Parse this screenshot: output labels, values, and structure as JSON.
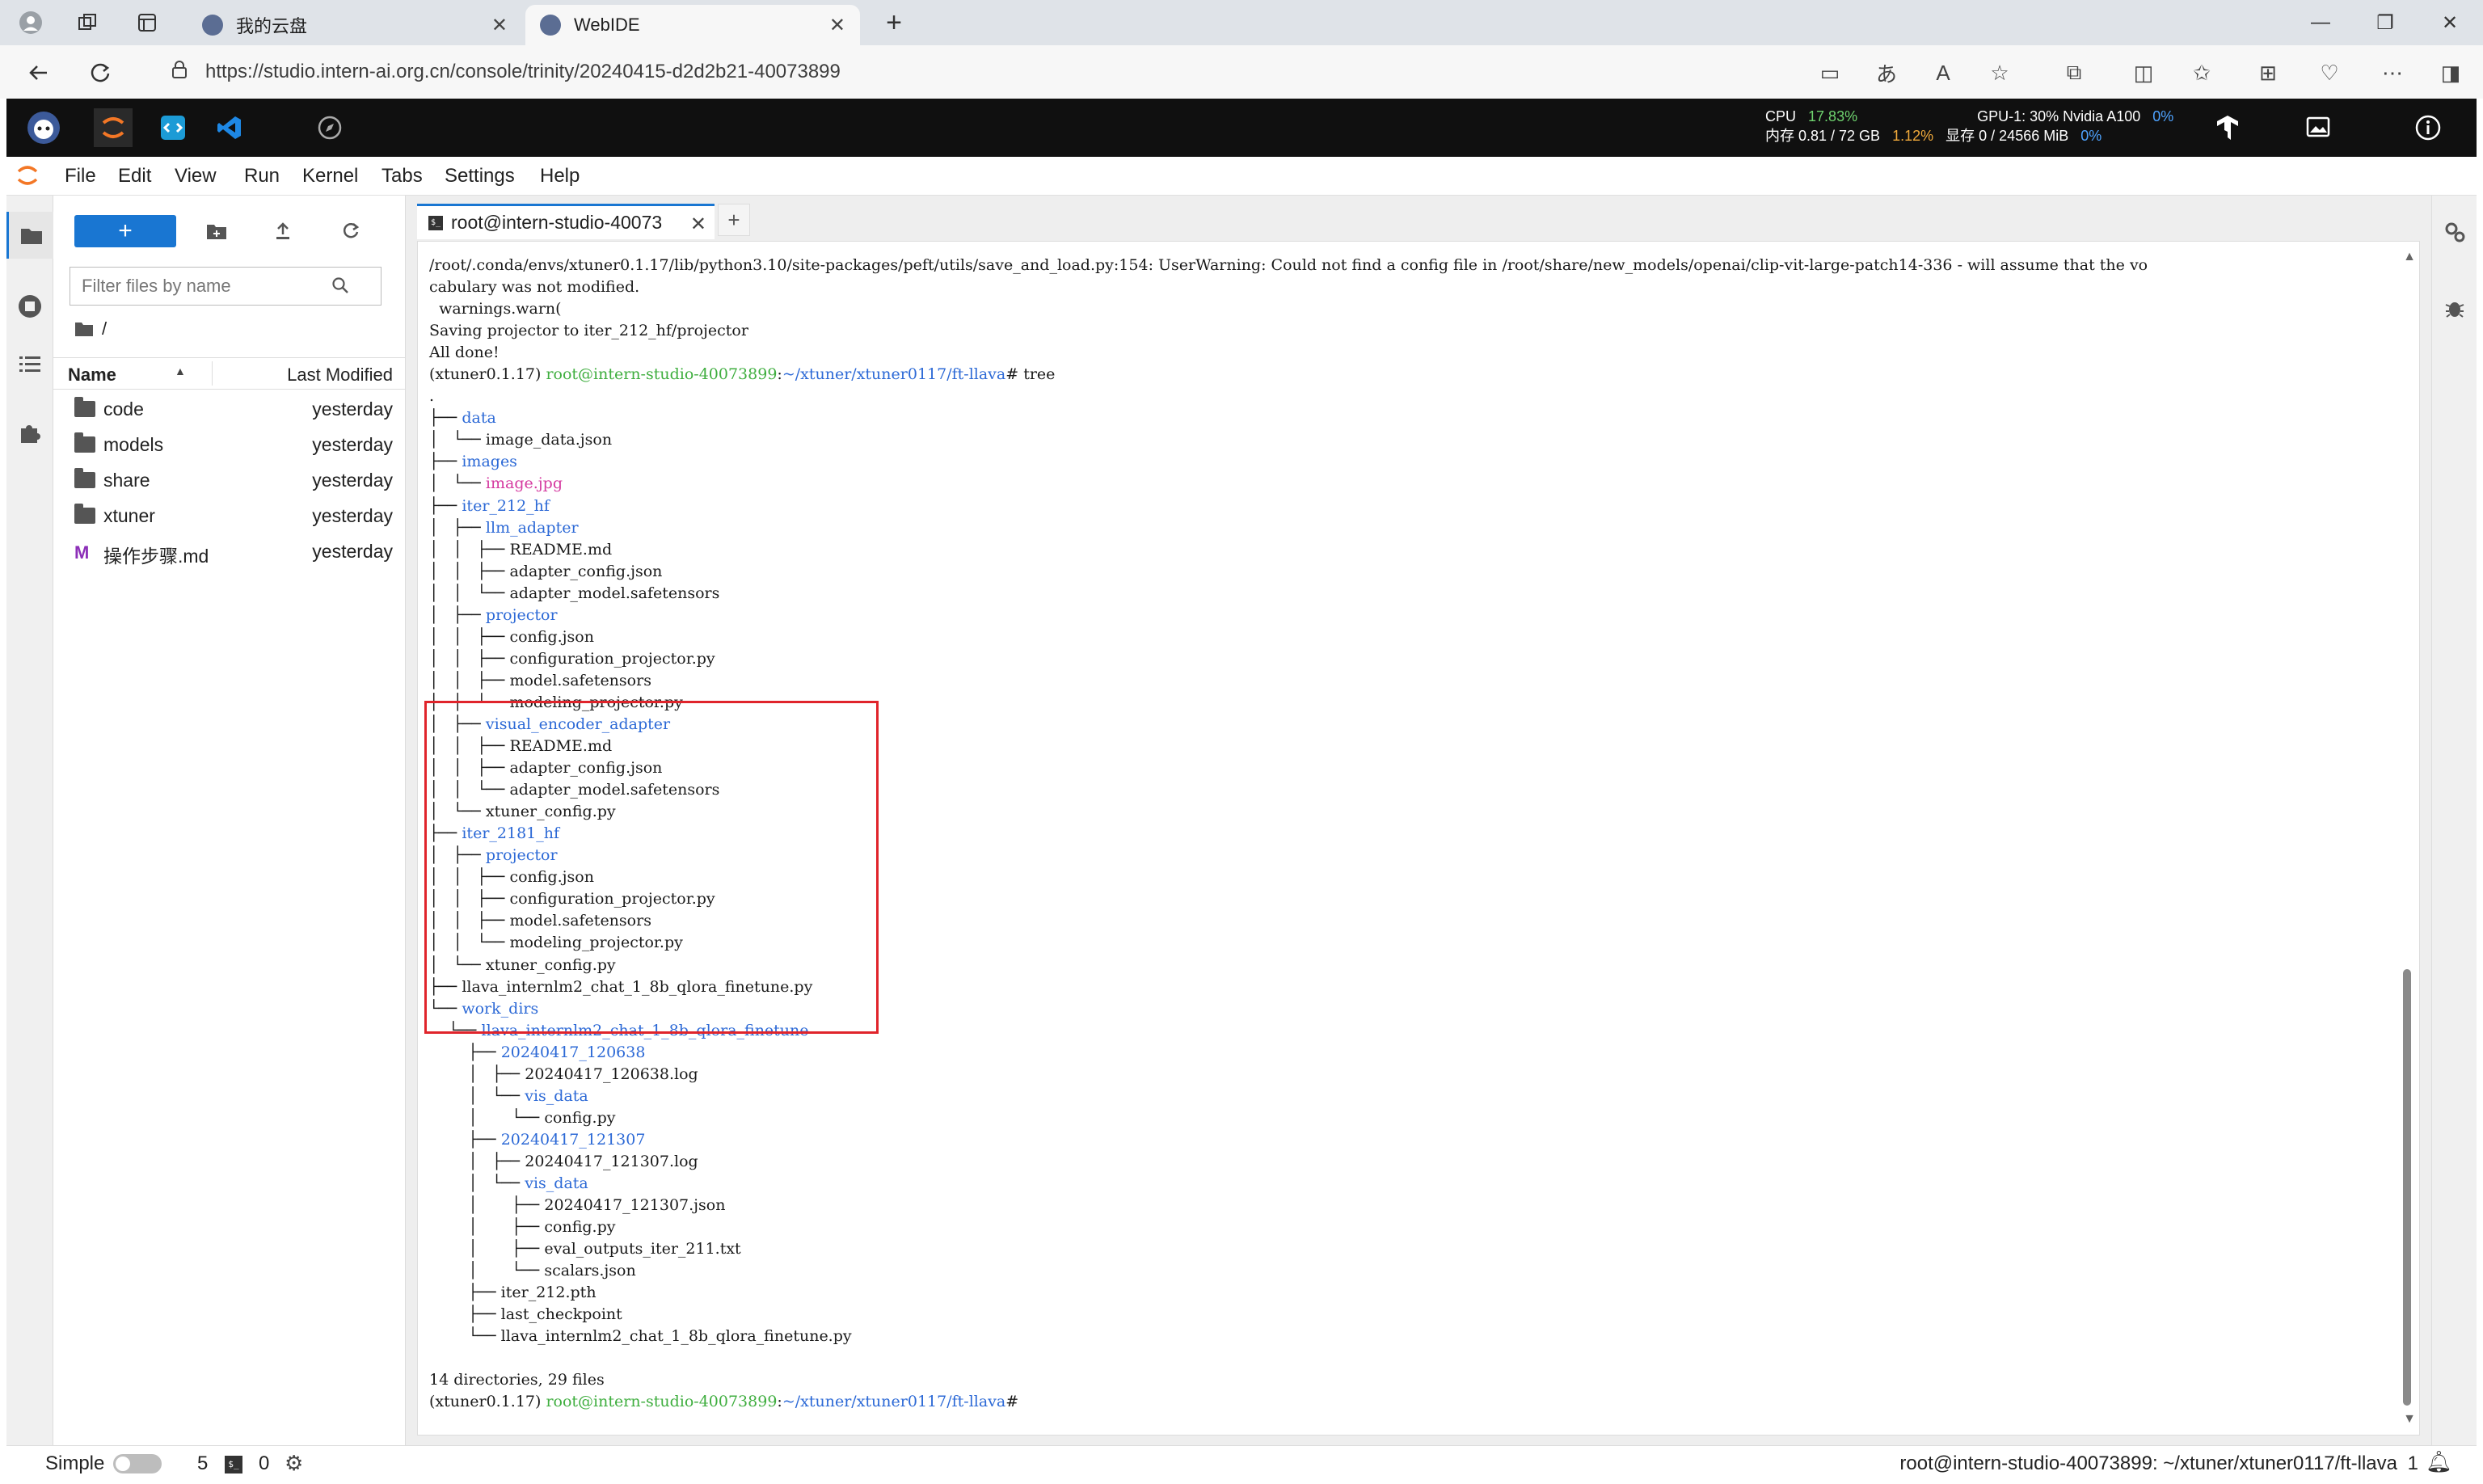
{
  "browser": {
    "tabs": [
      {
        "title": "我的云盘",
        "close": "✕"
      },
      {
        "title": "WebIDE",
        "close": "✕"
      }
    ],
    "new_tab": "+",
    "url": "https://studio.intern-ai.org.cn/console/trinity/20240415-d2d2b21-40073899",
    "window_controls": {
      "minimize": "—",
      "restore": "❐",
      "close": "✕"
    },
    "address_icons": [
      "clipboard-icon",
      "translate-icon",
      "read-aloud-icon",
      "favorite-star-icon",
      "extensions-icon",
      "split-screen-icon",
      "favorites-icon",
      "collections-icon",
      "heart-pulse-icon",
      "more-icon",
      "sidebar-icon"
    ]
  },
  "resources": {
    "cpu_label": "CPU",
    "cpu_value": "17.83%",
    "mem_label": "内存 0.81 / 72 GB",
    "mem_pct": "1.12%",
    "gpu_label": "GPU-1: 30% Nvidia A100",
    "gpu_pct": "0%",
    "vram_label": "显存 0 / 24566 MiB",
    "vram_pct": "0%"
  },
  "menu": {
    "items": [
      "File",
      "Edit",
      "View",
      "Run",
      "Kernel",
      "Tabs",
      "Settings",
      "Help"
    ]
  },
  "filebrowser": {
    "new_label": "+",
    "filter_placeholder": "Filter files by name",
    "breadcrumb": "/",
    "col_name": "Name",
    "col_modified": "Last Modified",
    "sort_indicator": "▲",
    "rows": [
      {
        "type": "folder",
        "name": "code",
        "modified": "yesterday"
      },
      {
        "type": "folder",
        "name": "models",
        "modified": "yesterday"
      },
      {
        "type": "folder",
        "name": "share",
        "modified": "yesterday"
      },
      {
        "type": "folder",
        "name": "xtuner",
        "modified": "yesterday"
      },
      {
        "type": "markdown",
        "name": "操作步骤.md",
        "modified": "yesterday"
      }
    ]
  },
  "terminal": {
    "tab_title": "root@intern-studio-40073",
    "tab_close": "✕",
    "new_tab": "+",
    "lines": [
      [
        {
          "t": "/root/.conda/envs/xtuner0.1.17/lib/python3.10/site-packages/peft/utils/save_and_load.py:154: UserWarning: Could not find a config file in /root/share/new_models/openai/clip-vit-large-patch14-336 - will assume that the vo"
        }
      ],
      [
        {
          "t": "cabulary was not modified."
        }
      ],
      [
        {
          "t": "  warnings.warn("
        }
      ],
      [
        {
          "t": "Saving projector to iter_212_hf/projector"
        }
      ],
      [
        {
          "t": "All done!"
        }
      ],
      [
        {
          "t": "(xtuner0.1.17) "
        },
        {
          "t": "root@intern-studio-40073899",
          "c": "ok"
        },
        {
          "t": ":"
        },
        {
          "t": "~/xtuner/xtuner0117/ft-llava",
          "c": "path"
        },
        {
          "t": "# tree"
        }
      ],
      [
        {
          "t": "."
        }
      ],
      [
        {
          "t": "├── "
        },
        {
          "t": "data",
          "c": "dir"
        }
      ],
      [
        {
          "t": "│   └── image_data.json"
        }
      ],
      [
        {
          "t": "├── "
        },
        {
          "t": "images",
          "c": "dir"
        }
      ],
      [
        {
          "t": "│   └── "
        },
        {
          "t": "image.jpg",
          "c": "pink"
        }
      ],
      [
        {
          "t": "├── "
        },
        {
          "t": "iter_212_hf",
          "c": "dir"
        }
      ],
      [
        {
          "t": "│   ├── "
        },
        {
          "t": "llm_adapter",
          "c": "dir"
        }
      ],
      [
        {
          "t": "│   │   ├── README.md"
        }
      ],
      [
        {
          "t": "│   │   ├── adapter_config.json"
        }
      ],
      [
        {
          "t": "│   │   └── adapter_model.safetensors"
        }
      ],
      [
        {
          "t": "│   ├── "
        },
        {
          "t": "projector",
          "c": "dir"
        }
      ],
      [
        {
          "t": "│   │   ├── config.json"
        }
      ],
      [
        {
          "t": "│   │   ├── configuration_projector.py"
        }
      ],
      [
        {
          "t": "│   │   ├── model.safetensors"
        }
      ],
      [
        {
          "t": "│   │   └── modeling_projector.py"
        }
      ],
      [
        {
          "t": "│   ├── "
        },
        {
          "t": "visual_encoder_adapter",
          "c": "dir"
        }
      ],
      [
        {
          "t": "│   │   ├── README.md"
        }
      ],
      [
        {
          "t": "│   │   ├── adapter_config.json"
        }
      ],
      [
        {
          "t": "│   │   └── adapter_model.safetensors"
        }
      ],
      [
        {
          "t": "│   └── xtuner_config.py"
        }
      ],
      [
        {
          "t": "├── "
        },
        {
          "t": "iter_2181_hf",
          "c": "dir"
        }
      ],
      [
        {
          "t": "│   ├── "
        },
        {
          "t": "projector",
          "c": "dir"
        }
      ],
      [
        {
          "t": "│   │   ├── config.json"
        }
      ],
      [
        {
          "t": "│   │   ├── configuration_projector.py"
        }
      ],
      [
        {
          "t": "│   │   ├── model.safetensors"
        }
      ],
      [
        {
          "t": "│   │   └── modeling_projector.py"
        }
      ],
      [
        {
          "t": "│   └── xtuner_config.py"
        }
      ],
      [
        {
          "t": "├── llava_internlm2_chat_1_8b_qlora_finetune.py"
        }
      ],
      [
        {
          "t": "└── "
        },
        {
          "t": "work_dirs",
          "c": "dir"
        }
      ],
      [
        {
          "t": "    └── "
        },
        {
          "t": "llava_internlm2_chat_1_8b_qlora_finetune",
          "c": "dir"
        }
      ],
      [
        {
          "t": "        ├── "
        },
        {
          "t": "20240417_120638",
          "c": "dir"
        }
      ],
      [
        {
          "t": "        │   ├── 20240417_120638.log"
        }
      ],
      [
        {
          "t": "        │   └── "
        },
        {
          "t": "vis_data",
          "c": "dir"
        }
      ],
      [
        {
          "t": "        │       └── config.py"
        }
      ],
      [
        {
          "t": "        ├── "
        },
        {
          "t": "20240417_121307",
          "c": "dir"
        }
      ],
      [
        {
          "t": "        │   ├── 20240417_121307.log"
        }
      ],
      [
        {
          "t": "        │   └── "
        },
        {
          "t": "vis_data",
          "c": "dir"
        }
      ],
      [
        {
          "t": "        │       ├── 20240417_121307.json"
        }
      ],
      [
        {
          "t": "        │       ├── config.py"
        }
      ],
      [
        {
          "t": "        │       ├── eval_outputs_iter_211.txt"
        }
      ],
      [
        {
          "t": "        │       └── scalars.json"
        }
      ],
      [
        {
          "t": "        ├── iter_212.pth"
        }
      ],
      [
        {
          "t": "        ├── last_checkpoint"
        }
      ],
      [
        {
          "t": "        └── llava_internlm2_chat_1_8b_qlora_finetune.py"
        }
      ],
      [
        {
          "t": ""
        }
      ],
      [
        {
          "t": "14 directories, 29 files"
        }
      ],
      [
        {
          "t": "(xtuner0.1.17) "
        },
        {
          "t": "root@intern-studio-40073899",
          "c": "ok"
        },
        {
          "t": ":"
        },
        {
          "t": "~/xtuner/xtuner0117/ft-llava",
          "c": "path"
        },
        {
          "t": "#"
        }
      ]
    ]
  },
  "statusbar": {
    "mode_label": "Simple",
    "kernels": "5",
    "terminals": "0",
    "path": "root@intern-studio-40073899: ~/xtuner/xtuner0117/ft-llava",
    "notifications": "1"
  },
  "colors": {
    "accent": "#1976d2",
    "jupyter_orange": "#f37726",
    "highlight_box": "#e0242b",
    "dir": "#2c69d6",
    "prompt_user": "#3fae3f"
  }
}
